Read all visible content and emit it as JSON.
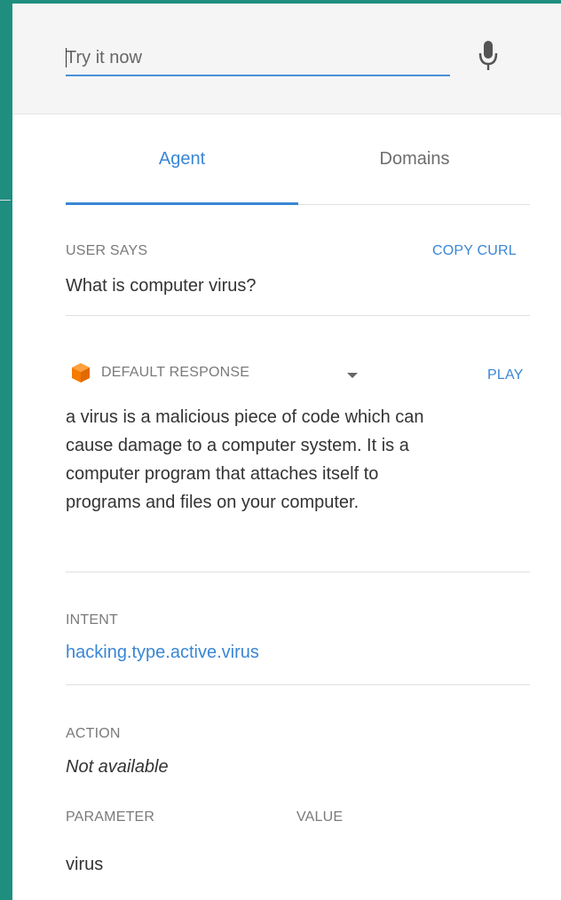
{
  "try_it": {
    "placeholder": "Try it now"
  },
  "tabs": [
    {
      "label": "Agent",
      "active": true
    },
    {
      "label": "Domains",
      "active": false
    }
  ],
  "user_says": {
    "label": "USER SAYS",
    "copy_curl": "COPY CURL",
    "text": "What is computer virus?"
  },
  "response": {
    "label": "DEFAULT RESPONSE",
    "play": "PLAY",
    "lines": [
      "a virus is a malicious piece of code which can",
      "cause damage to a computer system. It is a",
      "computer program that attaches itself to",
      "programs and files on your computer."
    ]
  },
  "intent": {
    "label": "INTENT",
    "value": "hacking.type.active.virus"
  },
  "action": {
    "label": "ACTION",
    "value": "Not available"
  },
  "parameters": {
    "col_parameter": "PARAMETER",
    "col_value": "VALUE",
    "rows": [
      {
        "parameter": "virus",
        "value": ""
      }
    ]
  },
  "colors": {
    "accent": "#3a86d4",
    "frame": "#1f8e7f",
    "cube": "#f57c00"
  },
  "icons": {
    "mic": "microphone-icon",
    "cube": "cube-icon",
    "caret": "dropdown-caret-icon"
  }
}
